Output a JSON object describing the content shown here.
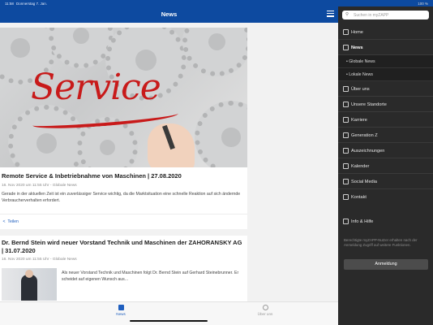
{
  "status": {
    "time": "11:58",
    "date": "Donnerstag 7. Jan.",
    "battery": "100 %"
  },
  "header": {
    "title": "News"
  },
  "articles": [
    {
      "title": "Remote Service & Inbetriebnahme von Maschinen | 27.08.2020",
      "meta": "16. Nov 2020 um 11:55 Uhr - Globale News",
      "text": "Gerade in der aktuellen Zeit ist ein zuverlässiger Service wichtig, da die Marktsituation eine schnelle Reaktion auf sich ändernde Verbraucherverhalten erfordert.",
      "share_label": "Teilen",
      "hero_word": "Service"
    },
    {
      "title": "Dr. Bernd Stein wird neuer Vorstand Technik und Maschinen der ZAHORANSKY AG | 31.07.2020",
      "meta": "16. Nov 2020 um 11:55 Uhr - Globale News",
      "text": "Als neuer Vorstand Technik und Maschinen folgt Dr. Bernd Stein auf Gerhard Steinebrunner. Er scheidet auf eigenen Wunsch aus..."
    }
  ],
  "tabs": [
    {
      "label": "News",
      "icon": "news-icon",
      "active": true
    },
    {
      "label": "Über uns",
      "icon": "info-icon",
      "active": false
    }
  ],
  "sidebar": {
    "search_placeholder": "Suchen in myZAPP",
    "items": [
      {
        "label": "Home",
        "icon": "home-icon"
      },
      {
        "label": "News",
        "icon": "news-icon",
        "active": true
      },
      {
        "label": "Globale News",
        "sub": true
      },
      {
        "label": "Lokale News",
        "sub": true
      },
      {
        "label": "Über uns",
        "icon": "building-icon"
      },
      {
        "label": "Unsere Standorte",
        "icon": "location-icon"
      },
      {
        "label": "Karriere",
        "icon": "briefcase-icon"
      },
      {
        "label": "Generation Z",
        "icon": "people-icon"
      },
      {
        "label": "Auszeichnungen",
        "icon": "award-icon"
      },
      {
        "label": "Kalender",
        "icon": "calendar-icon"
      },
      {
        "label": "Social Media",
        "icon": "share-icon"
      },
      {
        "label": "Kontakt",
        "icon": "contact-icon"
      },
      {
        "label": "Info & Hilfe",
        "icon": "help-icon"
      }
    ],
    "note": "Berechtigte myZAPP-Nutzer erhalten nach der Anmeldung Zugriff auf weitere Funktionen.",
    "login_label": "Anmeldung"
  },
  "colors": {
    "brand_blue": "#0d4aa0",
    "accent": "#c81a1a",
    "sidebar_bg": "#2a2a2a"
  }
}
